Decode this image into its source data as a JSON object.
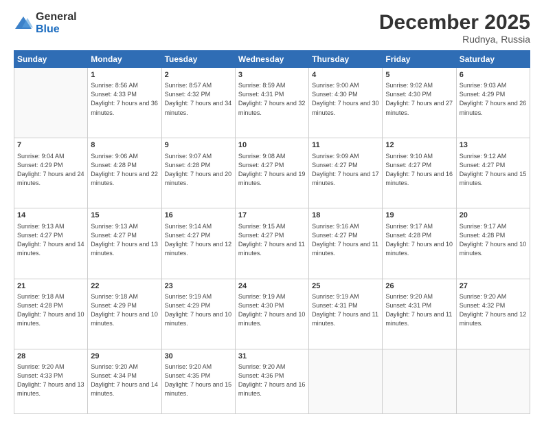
{
  "logo": {
    "general": "General",
    "blue": "Blue"
  },
  "header": {
    "month": "December 2025",
    "location": "Rudnya, Russia"
  },
  "weekdays": [
    "Sunday",
    "Monday",
    "Tuesday",
    "Wednesday",
    "Thursday",
    "Friday",
    "Saturday"
  ],
  "weeks": [
    [
      {
        "day": "",
        "info": ""
      },
      {
        "day": "1",
        "info": "Sunrise: 8:56 AM\nSunset: 4:33 PM\nDaylight: 7 hours\nand 36 minutes."
      },
      {
        "day": "2",
        "info": "Sunrise: 8:57 AM\nSunset: 4:32 PM\nDaylight: 7 hours\nand 34 minutes."
      },
      {
        "day": "3",
        "info": "Sunrise: 8:59 AM\nSunset: 4:31 PM\nDaylight: 7 hours\nand 32 minutes."
      },
      {
        "day": "4",
        "info": "Sunrise: 9:00 AM\nSunset: 4:30 PM\nDaylight: 7 hours\nand 30 minutes."
      },
      {
        "day": "5",
        "info": "Sunrise: 9:02 AM\nSunset: 4:30 PM\nDaylight: 7 hours\nand 27 minutes."
      },
      {
        "day": "6",
        "info": "Sunrise: 9:03 AM\nSunset: 4:29 PM\nDaylight: 7 hours\nand 26 minutes."
      }
    ],
    [
      {
        "day": "7",
        "info": "Sunrise: 9:04 AM\nSunset: 4:29 PM\nDaylight: 7 hours\nand 24 minutes."
      },
      {
        "day": "8",
        "info": "Sunrise: 9:06 AM\nSunset: 4:28 PM\nDaylight: 7 hours\nand 22 minutes."
      },
      {
        "day": "9",
        "info": "Sunrise: 9:07 AM\nSunset: 4:28 PM\nDaylight: 7 hours\nand 20 minutes."
      },
      {
        "day": "10",
        "info": "Sunrise: 9:08 AM\nSunset: 4:27 PM\nDaylight: 7 hours\nand 19 minutes."
      },
      {
        "day": "11",
        "info": "Sunrise: 9:09 AM\nSunset: 4:27 PM\nDaylight: 7 hours\nand 17 minutes."
      },
      {
        "day": "12",
        "info": "Sunrise: 9:10 AM\nSunset: 4:27 PM\nDaylight: 7 hours\nand 16 minutes."
      },
      {
        "day": "13",
        "info": "Sunrise: 9:12 AM\nSunset: 4:27 PM\nDaylight: 7 hours\nand 15 minutes."
      }
    ],
    [
      {
        "day": "14",
        "info": "Sunrise: 9:13 AM\nSunset: 4:27 PM\nDaylight: 7 hours\nand 14 minutes."
      },
      {
        "day": "15",
        "info": "Sunrise: 9:13 AM\nSunset: 4:27 PM\nDaylight: 7 hours\nand 13 minutes."
      },
      {
        "day": "16",
        "info": "Sunrise: 9:14 AM\nSunset: 4:27 PM\nDaylight: 7 hours\nand 12 minutes."
      },
      {
        "day": "17",
        "info": "Sunrise: 9:15 AM\nSunset: 4:27 PM\nDaylight: 7 hours\nand 11 minutes."
      },
      {
        "day": "18",
        "info": "Sunrise: 9:16 AM\nSunset: 4:27 PM\nDaylight: 7 hours\nand 11 minutes."
      },
      {
        "day": "19",
        "info": "Sunrise: 9:17 AM\nSunset: 4:28 PM\nDaylight: 7 hours\nand 10 minutes."
      },
      {
        "day": "20",
        "info": "Sunrise: 9:17 AM\nSunset: 4:28 PM\nDaylight: 7 hours\nand 10 minutes."
      }
    ],
    [
      {
        "day": "21",
        "info": "Sunrise: 9:18 AM\nSunset: 4:28 PM\nDaylight: 7 hours\nand 10 minutes."
      },
      {
        "day": "22",
        "info": "Sunrise: 9:18 AM\nSunset: 4:29 PM\nDaylight: 7 hours\nand 10 minutes."
      },
      {
        "day": "23",
        "info": "Sunrise: 9:19 AM\nSunset: 4:29 PM\nDaylight: 7 hours\nand 10 minutes."
      },
      {
        "day": "24",
        "info": "Sunrise: 9:19 AM\nSunset: 4:30 PM\nDaylight: 7 hours\nand 10 minutes."
      },
      {
        "day": "25",
        "info": "Sunrise: 9:19 AM\nSunset: 4:31 PM\nDaylight: 7 hours\nand 11 minutes."
      },
      {
        "day": "26",
        "info": "Sunrise: 9:20 AM\nSunset: 4:31 PM\nDaylight: 7 hours\nand 11 minutes."
      },
      {
        "day": "27",
        "info": "Sunrise: 9:20 AM\nSunset: 4:32 PM\nDaylight: 7 hours\nand 12 minutes."
      }
    ],
    [
      {
        "day": "28",
        "info": "Sunrise: 9:20 AM\nSunset: 4:33 PM\nDaylight: 7 hours\nand 13 minutes."
      },
      {
        "day": "29",
        "info": "Sunrise: 9:20 AM\nSunset: 4:34 PM\nDaylight: 7 hours\nand 14 minutes."
      },
      {
        "day": "30",
        "info": "Sunrise: 9:20 AM\nSunset: 4:35 PM\nDaylight: 7 hours\nand 15 minutes."
      },
      {
        "day": "31",
        "info": "Sunrise: 9:20 AM\nSunset: 4:36 PM\nDaylight: 7 hours\nand 16 minutes."
      },
      {
        "day": "",
        "info": ""
      },
      {
        "day": "",
        "info": ""
      },
      {
        "day": "",
        "info": ""
      }
    ]
  ]
}
